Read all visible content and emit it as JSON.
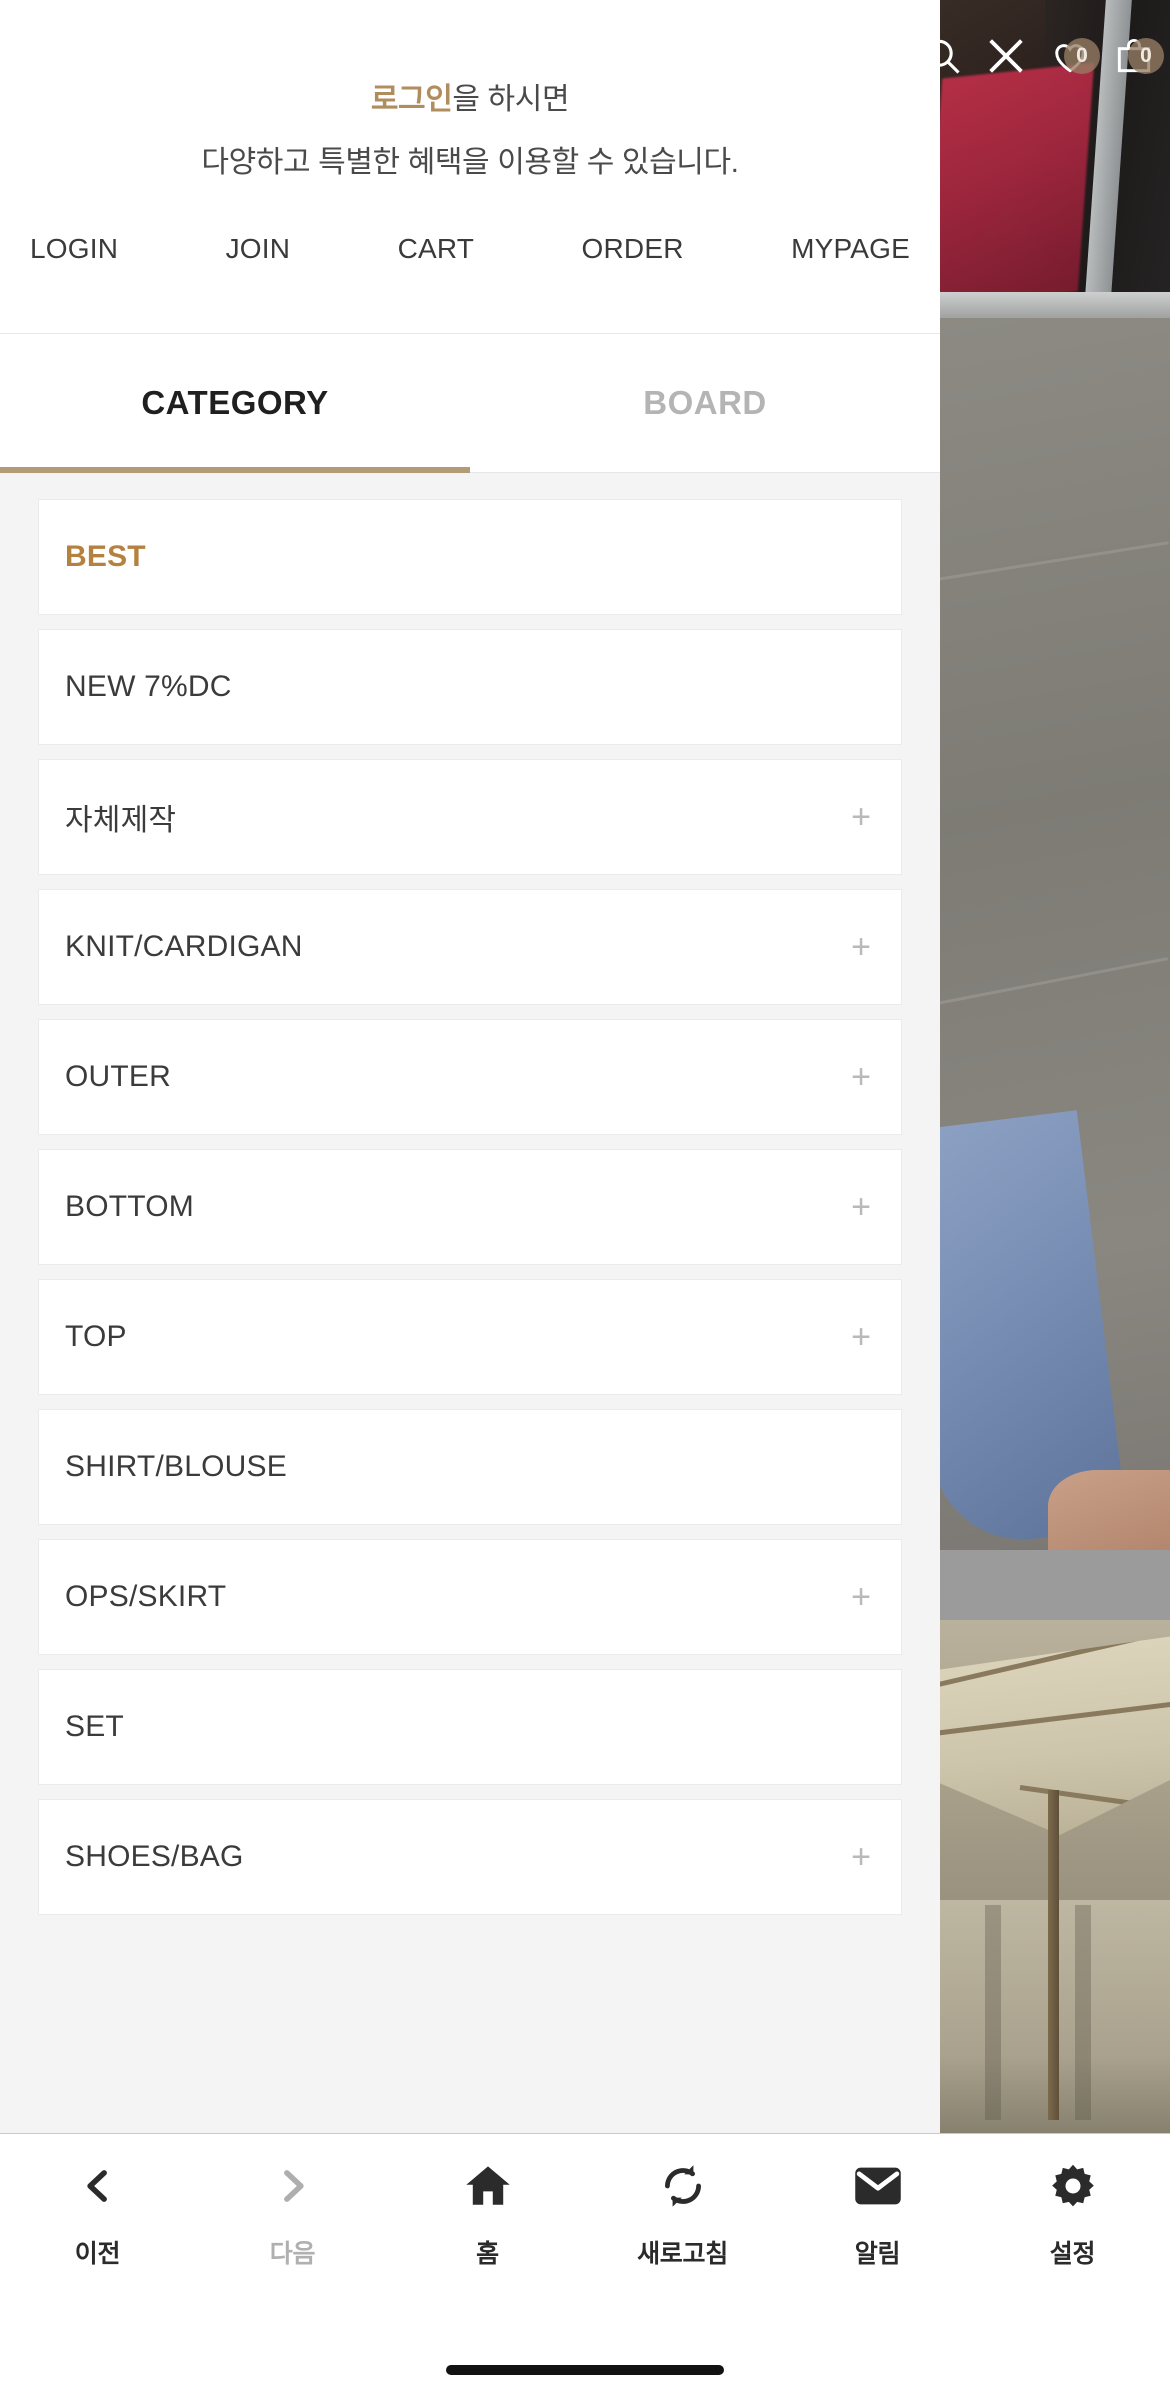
{
  "overlay_icons": [
    {
      "name": "search-icon",
      "badge": null
    },
    {
      "name": "close-icon",
      "badge": null
    },
    {
      "name": "heart-icon",
      "badge": "0"
    },
    {
      "name": "shopping-bag-icon",
      "badge": "0"
    }
  ],
  "promo": {
    "line1_highlight": "로그인",
    "line1_rest": "을 하시면",
    "line2": "다양하고 특별한 혜택을 이용할 수 있습니다.",
    "highlight_color": "#b08d5e"
  },
  "quicknav": [
    {
      "label": "LOGIN"
    },
    {
      "label": "JOIN"
    },
    {
      "label": "CART"
    },
    {
      "label": "ORDER"
    },
    {
      "label": "MYPAGE"
    }
  ],
  "tabs": [
    {
      "label": "CATEGORY",
      "active": true
    },
    {
      "label": "BOARD",
      "active": false
    }
  ],
  "tab_underline_color": "#b49b78",
  "categories": [
    {
      "label": "BEST",
      "expandable": false,
      "highlight": true
    },
    {
      "label": "NEW 7%DC",
      "expandable": false,
      "highlight": false
    },
    {
      "label": "자체제작",
      "expandable": true,
      "highlight": false
    },
    {
      "label": "KNIT/CARDIGAN",
      "expandable": true,
      "highlight": false
    },
    {
      "label": "OUTER",
      "expandable": true,
      "highlight": false
    },
    {
      "label": "BOTTOM",
      "expandable": true,
      "highlight": false
    },
    {
      "label": "TOP",
      "expandable": true,
      "highlight": false
    },
    {
      "label": "SHIRT/BLOUSE",
      "expandable": false,
      "highlight": false
    },
    {
      "label": "OPS/SKIRT",
      "expandable": true,
      "highlight": false
    },
    {
      "label": "SET",
      "expandable": false,
      "highlight": false
    },
    {
      "label": "SHOES/BAG",
      "expandable": true,
      "highlight": false
    }
  ],
  "expand_glyph": "+",
  "best_color": "#b5813f",
  "bottom_nav": [
    {
      "label": "이전",
      "icon": "chevron-left-icon",
      "disabled": false
    },
    {
      "label": "다음",
      "icon": "chevron-right-icon",
      "disabled": true
    },
    {
      "label": "홈",
      "icon": "home-icon",
      "disabled": false
    },
    {
      "label": "새로고침",
      "icon": "refresh-icon",
      "disabled": false
    },
    {
      "label": "알림",
      "icon": "mail-icon",
      "disabled": false
    },
    {
      "label": "설정",
      "icon": "gear-icon",
      "disabled": false
    }
  ]
}
